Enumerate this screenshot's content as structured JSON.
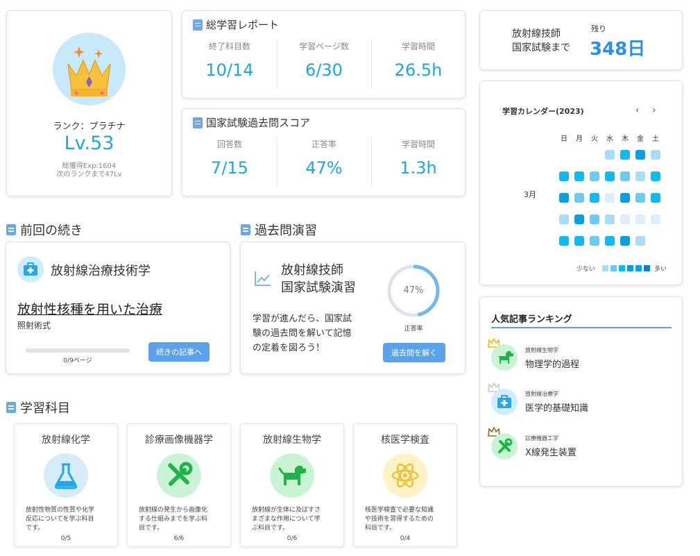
{
  "profile": {
    "rank_label": "ランク：プラチナ",
    "level": "Lv.53",
    "exp": "総獲得Exp:1604",
    "next": "次のランクまで47Lv"
  },
  "report": {
    "title": "総学習レポート",
    "stats": [
      {
        "label": "終了科目数",
        "value": "10/14"
      },
      {
        "label": "学習ページ数",
        "value": "6/30"
      },
      {
        "label": "学習時間",
        "value": "26.5h"
      }
    ]
  },
  "exam_score": {
    "title": "国家試験過去問スコア",
    "stats": [
      {
        "label": "回答数",
        "value": "7/15"
      },
      {
        "label": "正答率",
        "value": "47%"
      },
      {
        "label": "学習時間",
        "value": "1.3h"
      }
    ]
  },
  "countdown": {
    "line1": "放射線技師",
    "line2": "国家試験まで",
    "remaining_label": "残り",
    "days": "348日"
  },
  "calendar": {
    "title": "学習カレンダー(2023)",
    "weekdays": [
      "日",
      "月",
      "火",
      "水",
      "木",
      "金",
      "土"
    ],
    "month": "3月",
    "legend_low": "少ない",
    "legend_high": "多い",
    "colors": {
      "l1": "#dceefb",
      "l2": "#a9dcf5",
      "l3": "#6fcaf0",
      "l4": "#12b8ee",
      "l5": "#0a9fe0",
      "l6": "#0a7fc2"
    },
    "weeks": [
      [
        0,
        0,
        0,
        2,
        4,
        5,
        2
      ],
      [
        4,
        4,
        3,
        4,
        3,
        2,
        4
      ],
      [
        5,
        3,
        4,
        1,
        5,
        3,
        4
      ],
      [
        2,
        5,
        3,
        2,
        1,
        1,
        1
      ],
      [
        4,
        4,
        3,
        4,
        5,
        2,
        0
      ]
    ]
  },
  "continue_section": {
    "heading": "前回の続き",
    "subject": "放射線治療技術学",
    "article_title": "放射性核種を用いた治療",
    "article_sub": "照射術式",
    "progress_text": "0/9ページ",
    "progress": 0,
    "button": "続きの記事へ"
  },
  "practice_section": {
    "heading": "過去問演習",
    "title_line1": "放射線技師",
    "title_line2": "国家試験演習",
    "percent_text": "47%",
    "percent": 47,
    "percent_label": "正答率",
    "desc_lines": [
      "学習が進んだら、国家試",
      "験の過去問を解いて記憶",
      "の定着を図ろう！"
    ],
    "button": "過去問を解く"
  },
  "subjects_section": {
    "heading": "学習科目",
    "items": [
      {
        "title": "放射線化学",
        "icon": "flask-icon",
        "bg": "#d6ecfb",
        "fg": "#22a7ee",
        "desc_lines": [
          "放射性物質の性質や化学",
          "反応についてを学ぶ科目",
          "です。"
        ],
        "progress": "0/5"
      },
      {
        "title": "診療画像機器学",
        "icon": "tools-icon",
        "bg": "#c9f5d4",
        "fg": "#1fb34a",
        "desc_lines": [
          "放射線の発生から画像化",
          "する仕組みまでを学ぶ科",
          "目です。"
        ],
        "progress": "6/6"
      },
      {
        "title": "放射線生物学",
        "icon": "dog-icon",
        "bg": "#c9f5d4",
        "fg": "#1fb34a",
        "desc_lines": [
          "放射線が生体に及ぼすさ",
          "まざまな作用について学",
          "ぶ科目です。"
        ],
        "progress": "0/6"
      },
      {
        "title": "核医学検査",
        "icon": "atom-icon",
        "bg": "#fdf3c4",
        "fg": "#f2c13a",
        "desc_lines": [
          "核医学検査で必要な知識",
          "や技術を習得するための",
          "科目です。"
        ],
        "progress": "0/4"
      }
    ]
  },
  "ranking": {
    "title": "人気記事ランキング",
    "items": [
      {
        "category": "放射線生物学",
        "title": "物理学的過程",
        "icon": "dog-icon",
        "crown": "#f5b800"
      },
      {
        "category": "放射線治療学",
        "title": "医学的基礎知識",
        "icon": "medkit-icon",
        "crown": "#c8c8c8"
      },
      {
        "category": "診療機器工学",
        "title": "X線発生装置",
        "icon": "tools-icon",
        "crown": "#a0642a"
      }
    ]
  }
}
